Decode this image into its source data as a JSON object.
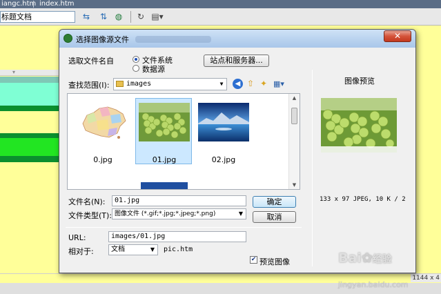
{
  "editor": {
    "tabs": [
      "iangc.htm",
      "index.htm"
    ],
    "title_input": "标题文档",
    "status_size": "1144 x 4"
  },
  "dialog": {
    "title": "选择图像源文件",
    "select_from_label": "选取文件名自",
    "radio_filesystem": "文件系统",
    "radio_datasource": "数据源",
    "sites_button": "站点和服务器...",
    "look_in_label": "查找范围(I):",
    "look_in_value": "images",
    "files": [
      {
        "name": "0.jpg",
        "selected": false
      },
      {
        "name": "01.jpg",
        "selected": true
      },
      {
        "name": "02.jpg",
        "selected": false
      }
    ],
    "filename_label": "文件名(N):",
    "filename_value": "01.jpg",
    "filetype_label": "文件类型(T):",
    "filetype_value": "图像文件 (*.gif;*.jpg;*.jpeg;*.png)",
    "ok_button": "确定",
    "cancel_button": "取消",
    "url_label": "URL:",
    "url_value": "images/01.jpg",
    "relative_label": "相对于:",
    "relative_value": "文档",
    "relative_file": "pic.htm",
    "preview_title": "图像预览",
    "preview_info": "133 x 97 JPEG, 10 K / 2",
    "preview_checkbox": "预览图像",
    "preview_checked": true
  },
  "watermark": {
    "text": "Bai",
    "text2": "经验",
    "sub": "jingyan.baidu.com"
  }
}
